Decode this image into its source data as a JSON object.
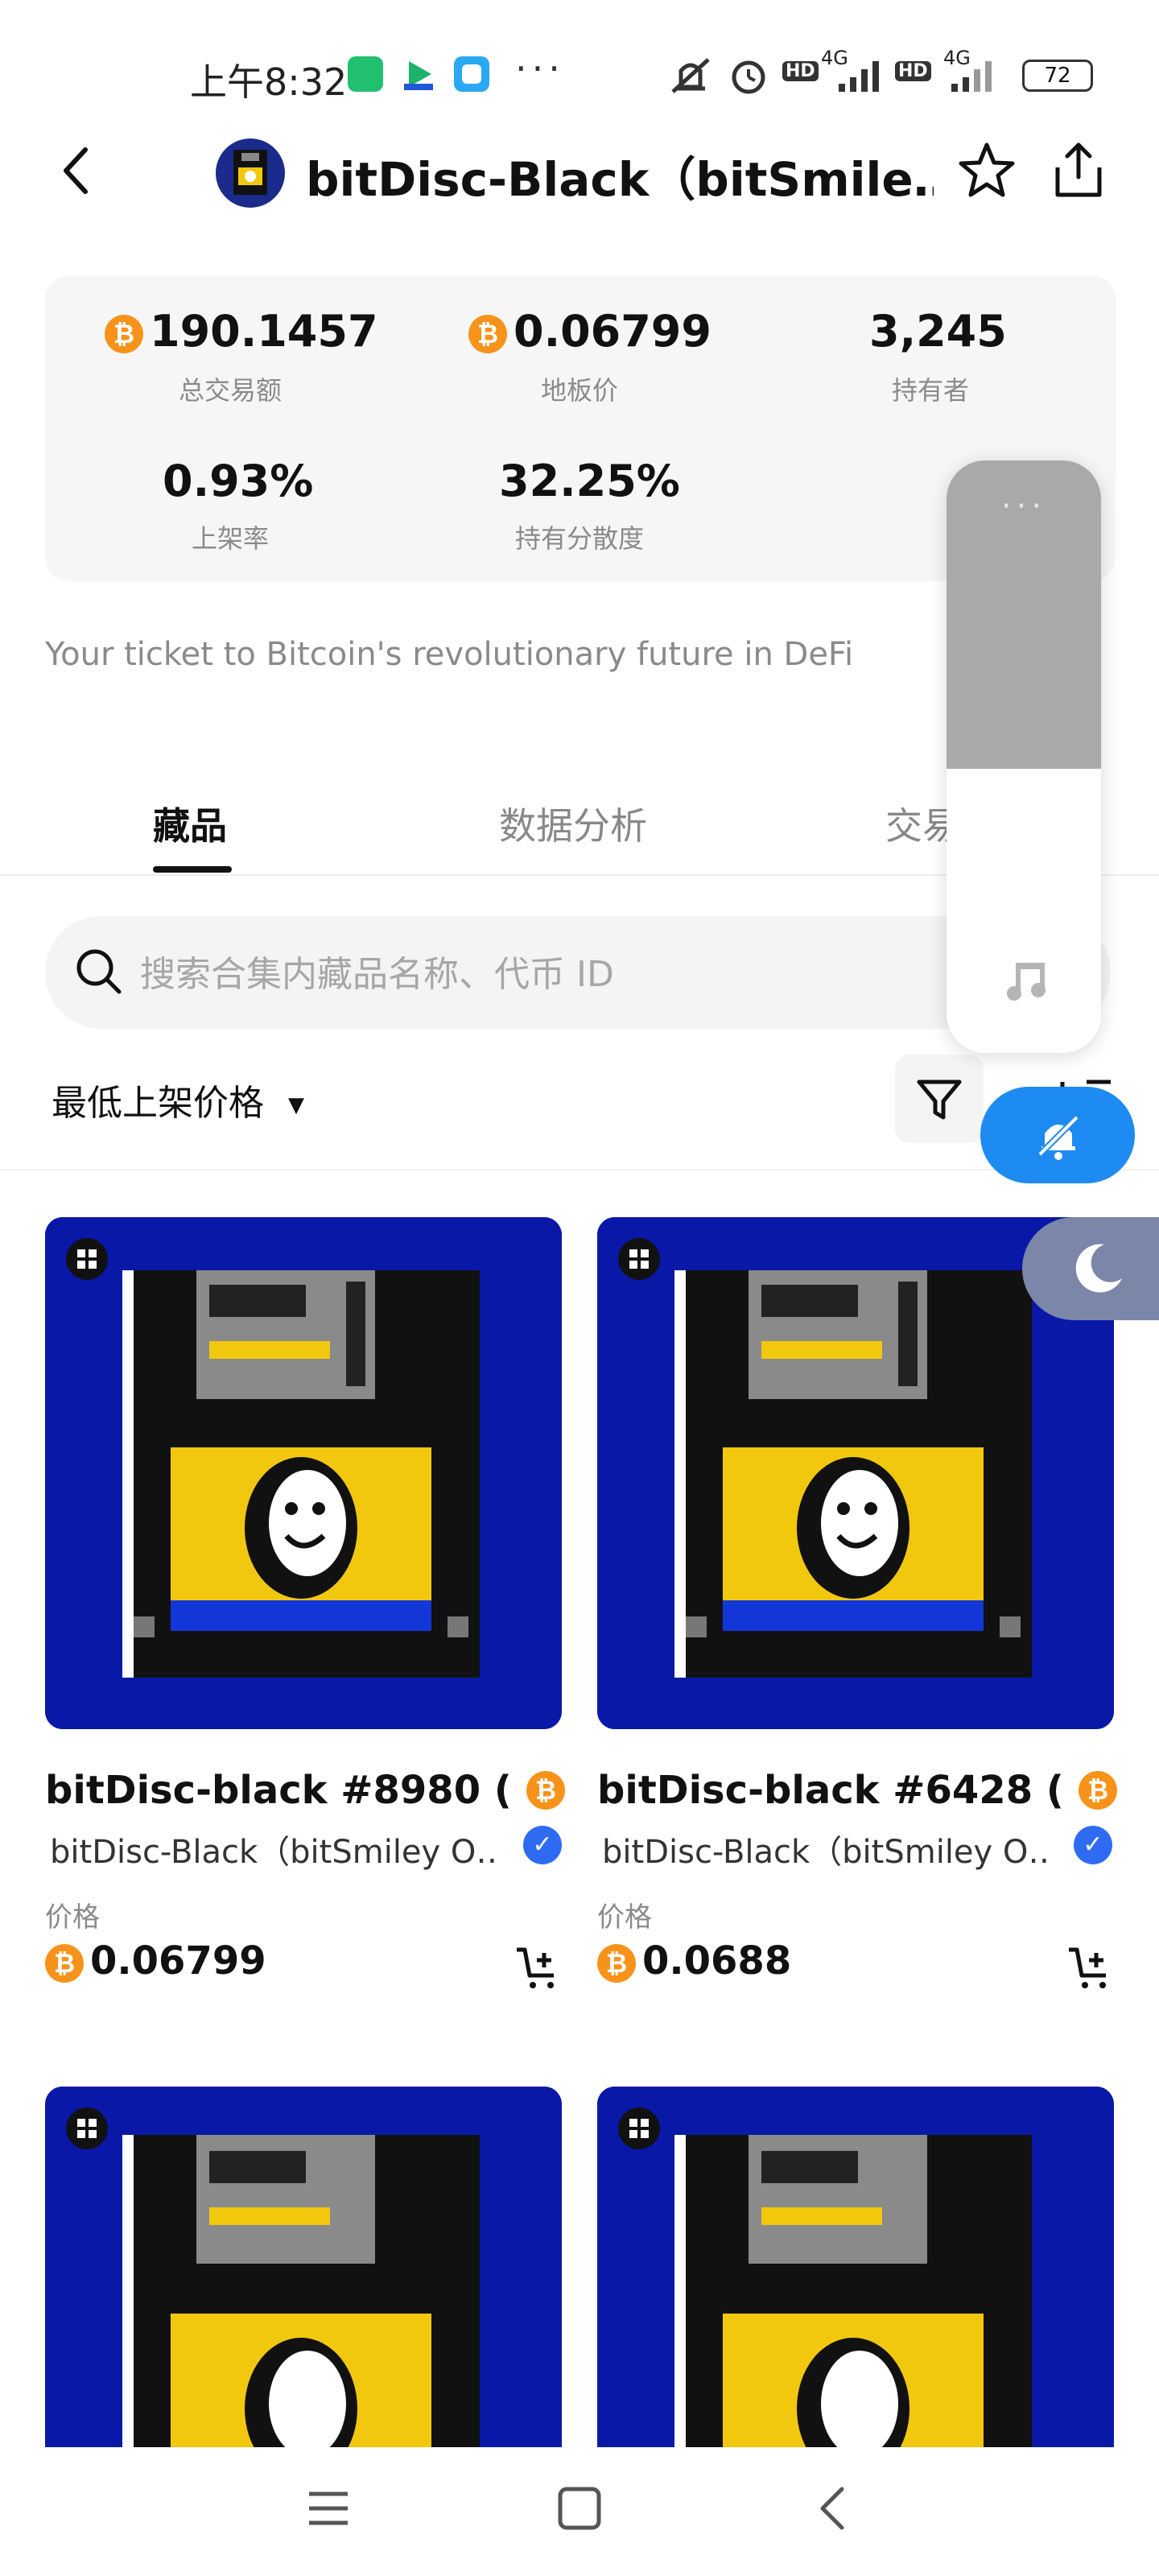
{
  "status_bar": {
    "time": "上午8:32",
    "more": "···",
    "net1": "4G",
    "net2": "4G",
    "hd": "HD",
    "battery": "72"
  },
  "header": {
    "title": "bitDisc-Black（bitSmile…"
  },
  "stats": {
    "volume_value": "190.1457",
    "volume_label": "总交易额",
    "floor_value": "0.06799",
    "floor_label": "地板价",
    "holders_value": "3,245",
    "holders_label": "持有者",
    "listed_value": "0.93%",
    "listed_label": "上架率",
    "dispersion_value": "32.25%",
    "dispersion_label": "持有分散度"
  },
  "description": "Your ticket to Bitcoin's revolutionary future in DeFi",
  "tabs": [
    {
      "label": "藏品"
    },
    {
      "label": "数据分析"
    },
    {
      "label": "交易"
    }
  ],
  "search": {
    "placeholder": "搜索合集内藏品名称、代币 ID"
  },
  "sort": {
    "label": "最低上架价格"
  },
  "cards": [
    {
      "title": "bitDisc-black #8980 (I…",
      "collection": "bitDisc-Black（bitSmiley O…",
      "price_label": "价格",
      "price": "0.06799"
    },
    {
      "title": "bitDisc-black #6428 (I…",
      "collection": "bitDisc-Black（bitSmiley O…",
      "price_label": "价格",
      "price": "0.0688"
    }
  ],
  "colors": {
    "btc_orange": "#f7931a",
    "card_blue": "#0a18a8",
    "dnd_blue": "#1d8bf2",
    "verified_blue": "#2f6bf2"
  },
  "volume_overlay": {
    "level_fraction": 0.48
  }
}
